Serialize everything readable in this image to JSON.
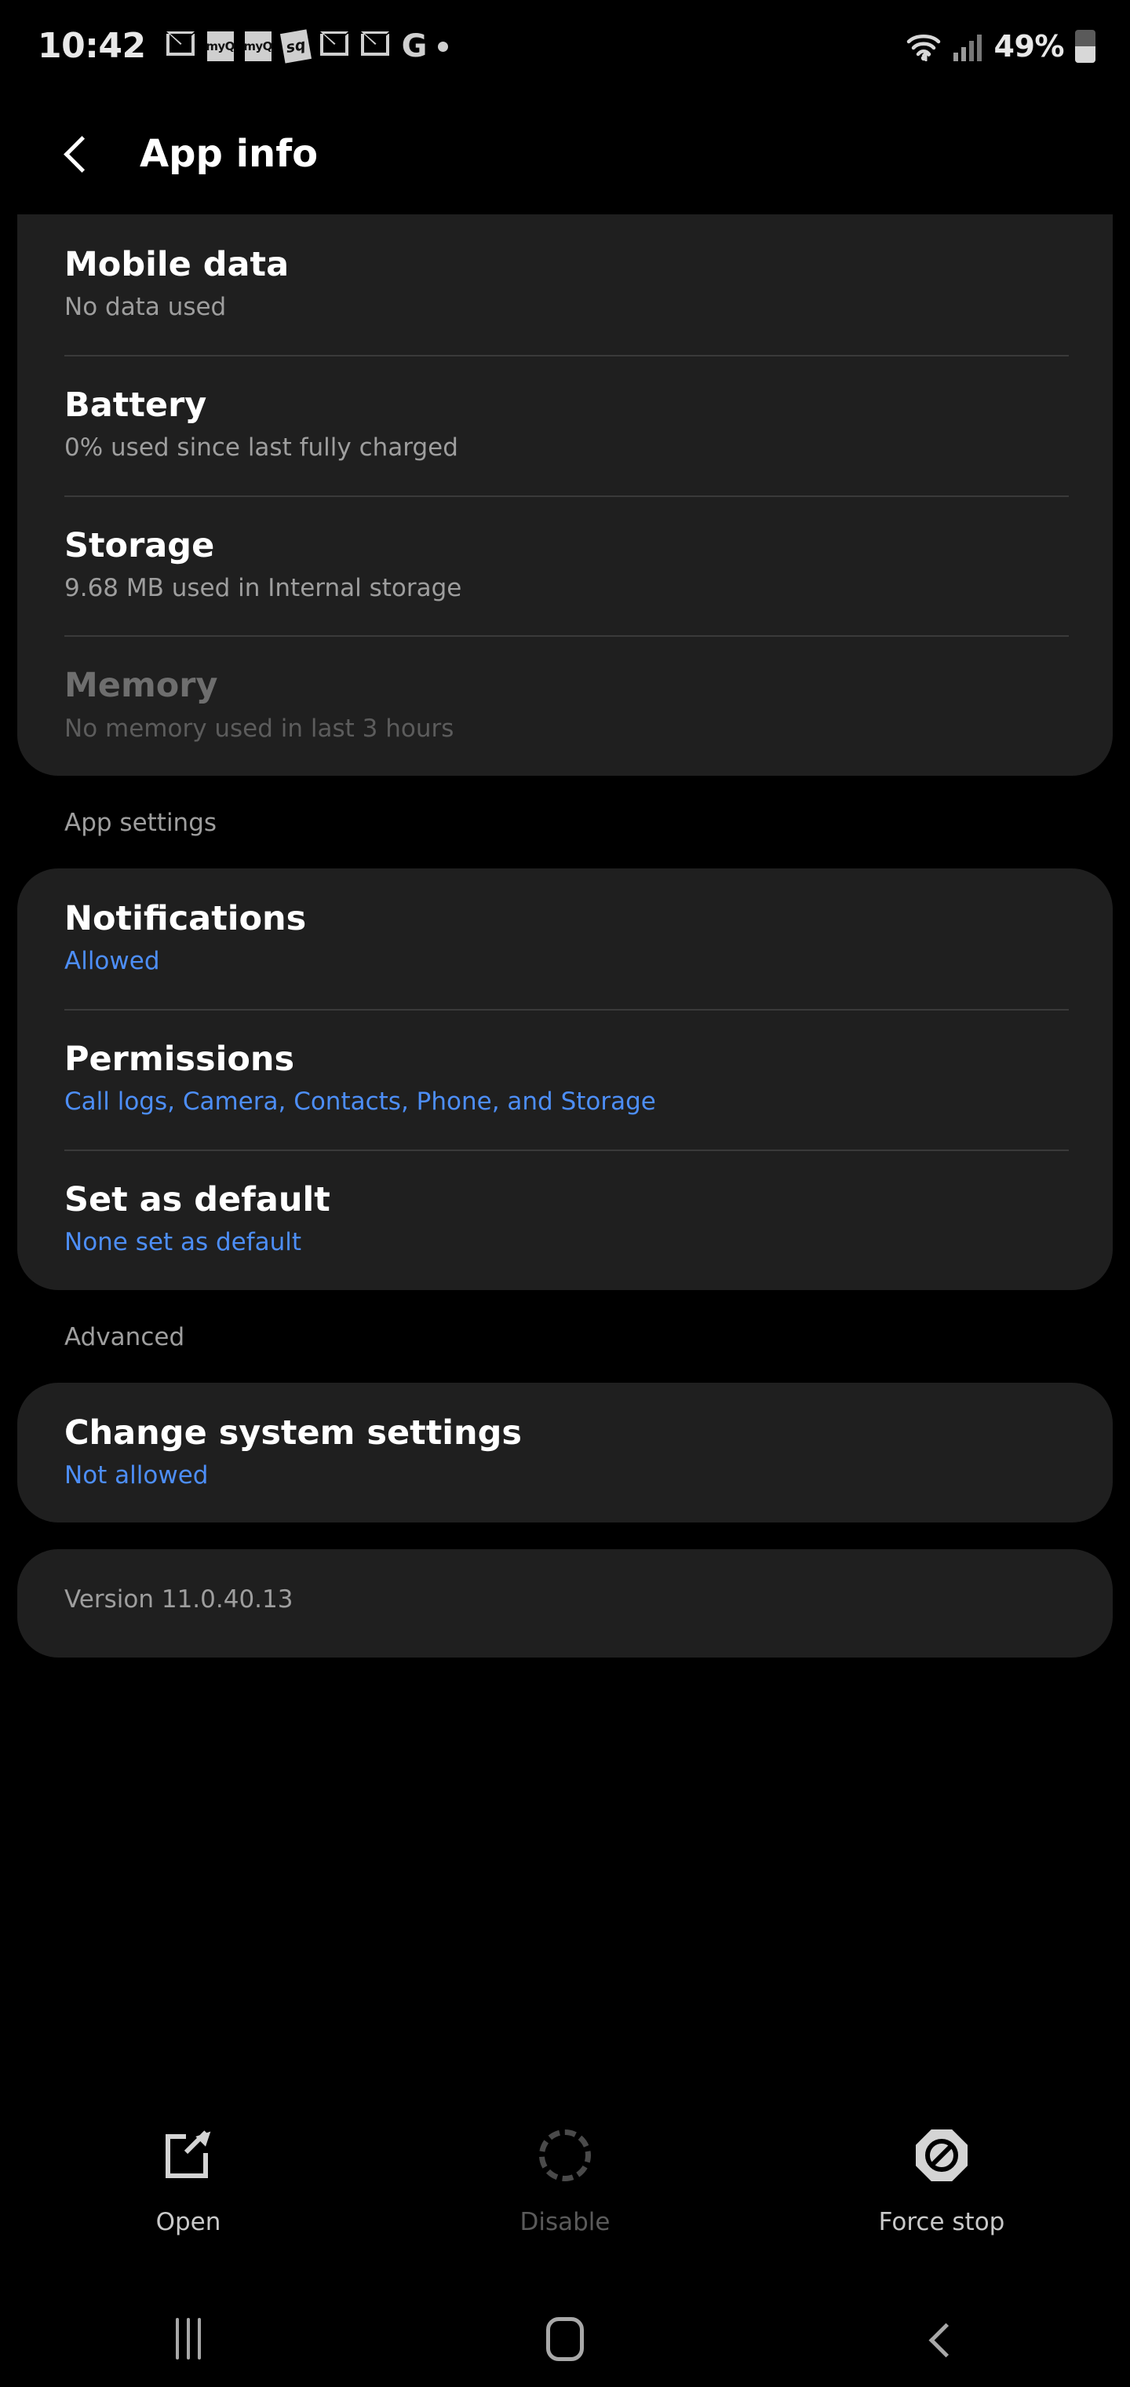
{
  "status_bar": {
    "clock": "10:42",
    "battery_percent": "49%",
    "battery_level": 49,
    "left_icons": [
      {
        "name": "gmail-icon",
        "glyph": "M"
      },
      {
        "name": "myq-icon",
        "glyph": "myQ"
      },
      {
        "name": "myq-icon-2",
        "glyph": "myQ"
      },
      {
        "name": "sq-app-icon",
        "glyph": "sq"
      },
      {
        "name": "gmail-icon-2",
        "glyph": "M"
      },
      {
        "name": "gmail-icon-3",
        "glyph": "M"
      },
      {
        "name": "google-icon",
        "glyph": "G"
      },
      {
        "name": "more-notifications-dot-icon",
        "glyph": "•"
      }
    ],
    "right_icons": [
      {
        "name": "wifi-icon"
      },
      {
        "name": "mobile-signal-icon"
      }
    ]
  },
  "app_bar": {
    "back_label": "Back",
    "title": "App info"
  },
  "usage_card": {
    "rows": [
      {
        "name": "mobile-data",
        "title": "Mobile data",
        "subtitle": "No data used",
        "subtitle_style": "muted",
        "disabled": false
      },
      {
        "name": "battery",
        "title": "Battery",
        "subtitle": "0% used since last fully charged",
        "subtitle_style": "muted",
        "disabled": false
      },
      {
        "name": "storage",
        "title": "Storage",
        "subtitle": "9.68 MB used in Internal storage",
        "subtitle_style": "muted",
        "disabled": false
      },
      {
        "name": "memory",
        "title": "Memory",
        "subtitle": "No memory used in last 3 hours",
        "subtitle_style": "muted",
        "disabled": true
      }
    ]
  },
  "app_settings": {
    "header": "App settings",
    "rows": [
      {
        "name": "notifications",
        "title": "Notifications",
        "subtitle": "Allowed",
        "subtitle_style": "link",
        "disabled": false
      },
      {
        "name": "permissions",
        "title": "Permissions",
        "subtitle": "Call logs, Camera, Contacts, Phone, and Storage",
        "subtitle_style": "link",
        "disabled": false
      },
      {
        "name": "set-as-default",
        "title": "Set as default",
        "subtitle": "None set as default",
        "subtitle_style": "link",
        "disabled": false
      }
    ]
  },
  "advanced": {
    "header": "Advanced",
    "rows": [
      {
        "name": "change-system-settings",
        "title": "Change system settings",
        "subtitle": "Not allowed",
        "subtitle_style": "link",
        "disabled": false
      }
    ]
  },
  "version_card": {
    "text": "Version 11.0.40.13"
  },
  "action_bar": {
    "actions": [
      {
        "name": "open",
        "label": "Open",
        "icon": "open-in-new-icon",
        "disabled": false
      },
      {
        "name": "disable",
        "label": "Disable",
        "icon": "disable-dashed-circle-icon",
        "disabled": true
      },
      {
        "name": "force-stop",
        "label": "Force stop",
        "icon": "force-stop-octagon-icon",
        "disabled": false
      }
    ]
  },
  "nav_bar": {
    "recents_label": "Recents",
    "home_label": "Home",
    "back_label": "Back"
  },
  "colors": {
    "background": "#000000",
    "card": "#1f1f1f",
    "title_text": "#ffffff",
    "muted_text": "#9e9e9e",
    "link_blue": "#4d8ef7",
    "disabled_text": "#6e6e6e",
    "divider": "#3a3a3a"
  }
}
